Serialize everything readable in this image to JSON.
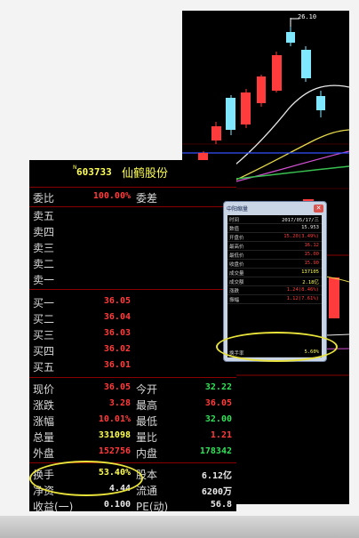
{
  "quote": {
    "flag": "N",
    "code": "603733",
    "name": "仙鹤股份",
    "weibi": {
      "label": "委比",
      "value": "100.00%",
      "label2": "委差"
    },
    "sell_levels": [
      "卖五",
      "卖四",
      "卖三",
      "卖二",
      "卖一"
    ],
    "buy_levels": [
      {
        "label": "买一",
        "price": "36.05"
      },
      {
        "label": "买二",
        "price": "36.04"
      },
      {
        "label": "买三",
        "price": "36.03"
      },
      {
        "label": "买四",
        "price": "36.02"
      },
      {
        "label": "买五",
        "price": "36.01"
      }
    ],
    "stats": [
      {
        "l1": "现价",
        "v1": "36.05",
        "c1": "red",
        "l2": "今开",
        "v2": "32.22",
        "c2": "green"
      },
      {
        "l1": "涨跌",
        "v1": "3.28",
        "c1": "red",
        "l2": "最高",
        "v2": "36.05",
        "c2": "red"
      },
      {
        "l1": "涨幅",
        "v1": "10.01%",
        "c1": "red",
        "l2": "最低",
        "v2": "32.00",
        "c2": "green"
      },
      {
        "l1": "总量",
        "v1": "331098",
        "c1": "yellow",
        "l2": "量比",
        "v2": "1.21",
        "c2": "red"
      },
      {
        "l1": "外盘",
        "v1": "152756",
        "c1": "red",
        "l2": "内盘",
        "v2": "178342",
        "c2": "green"
      }
    ],
    "turnover": {
      "label": "换手",
      "value": "53.40%",
      "label2": "股本",
      "value2": "6.12亿"
    },
    "net_asset": {
      "label": "净资",
      "value": "4.44",
      "label2": "流通",
      "value2": "6200万"
    },
    "earnings": {
      "label": "收益(一)",
      "value": "0.100",
      "label2": "PE(动)",
      "value2": "56.8"
    }
  },
  "chart": {
    "high_label": "26.10"
  },
  "popup": {
    "title": "中阳缩量",
    "rows": [
      {
        "label": "时间",
        "value": "2017/05/17/三",
        "color": "white"
      },
      {
        "label": "数值",
        "value": "15.953",
        "color": "white"
      },
      {
        "label": "开盘价",
        "value": "15.20(3.49%)",
        "color": "red"
      },
      {
        "label": "最高价",
        "value": "16.12",
        "color": "red"
      },
      {
        "label": "最低价",
        "value": "15.00",
        "color": "red"
      },
      {
        "label": "收盘价",
        "value": "15.90",
        "color": "red"
      },
      {
        "label": "成交量",
        "value": "137105",
        "color": "yellow"
      },
      {
        "label": "成交额",
        "value": "2.18亿",
        "color": "yellow"
      },
      {
        "label": "涨跌",
        "value": "1.24(8.46%)",
        "color": "red"
      },
      {
        "label": "振幅",
        "value": "1.12(7.61%)",
        "color": "red"
      },
      {
        "label": "换手率",
        "value": "5.60%",
        "color": "yellow"
      }
    ]
  },
  "colors": {
    "up": "#ff3b3b",
    "down": "#35e05a",
    "highlight": "#ffff55",
    "annotation": "#e8e23a",
    "cyan_candle": "#7fe7ff",
    "panel_bg": "#000000"
  }
}
